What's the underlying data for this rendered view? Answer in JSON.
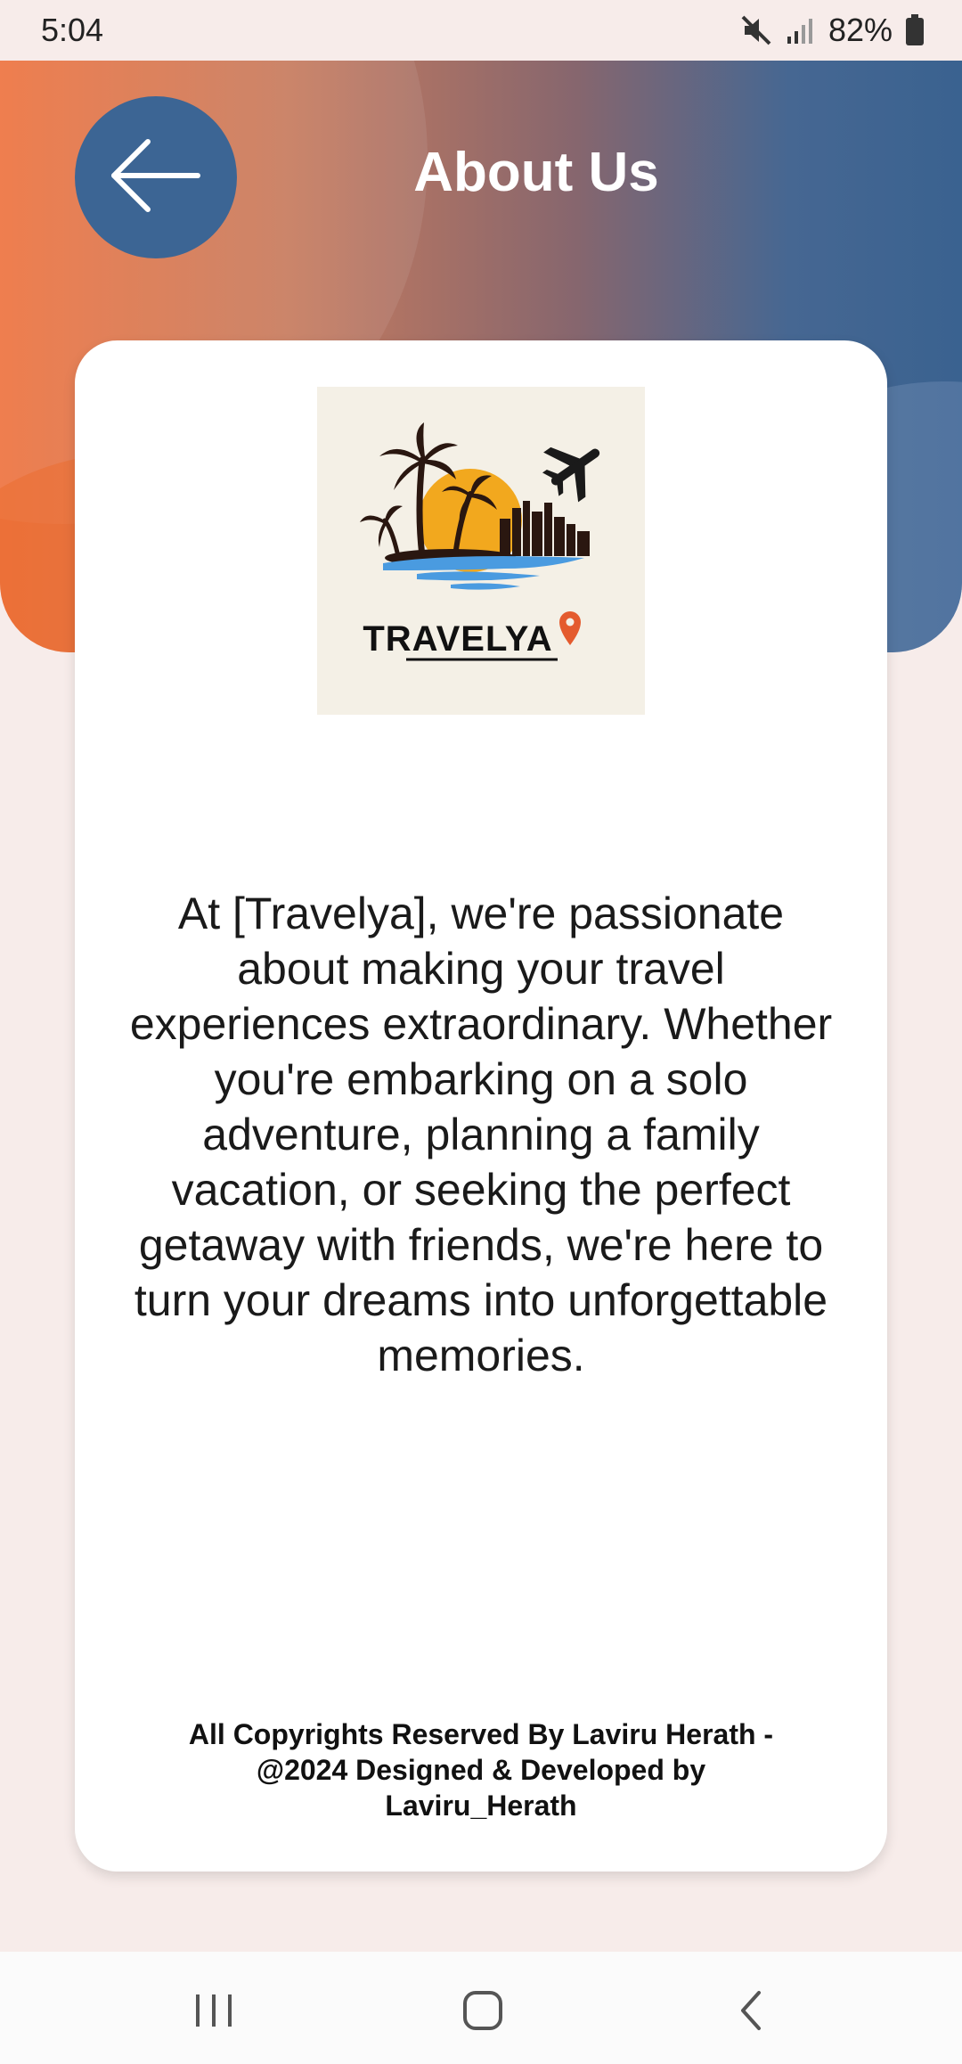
{
  "status_bar": {
    "time": "5:04",
    "battery_percent": "82%",
    "icons": [
      "mute-icon",
      "signal-icon",
      "battery-icon"
    ]
  },
  "header": {
    "title": "About Us",
    "back_icon": "arrow-left-icon",
    "colors": {
      "left": "#ee7440",
      "right": "#3a6290",
      "back_button": "#3c6594"
    }
  },
  "card": {
    "logo": {
      "brand_text": "TRAVELYA",
      "icon": "location-pin-icon"
    },
    "about_text": "At [Travelya], we're passionate about making your travel experiences extraordinary. Whether you're embarking on a solo adventure, planning a family vacation, or seeking the perfect getaway with friends, we're here to turn your dreams into unforgettable memories.",
    "copyright": "All Copyrights Reserved By Laviru Herath - @2024 Designed & Developed by Laviru_Herath"
  },
  "nav_bar": {
    "items": [
      "recent-apps-icon",
      "home-icon",
      "back-icon"
    ]
  }
}
